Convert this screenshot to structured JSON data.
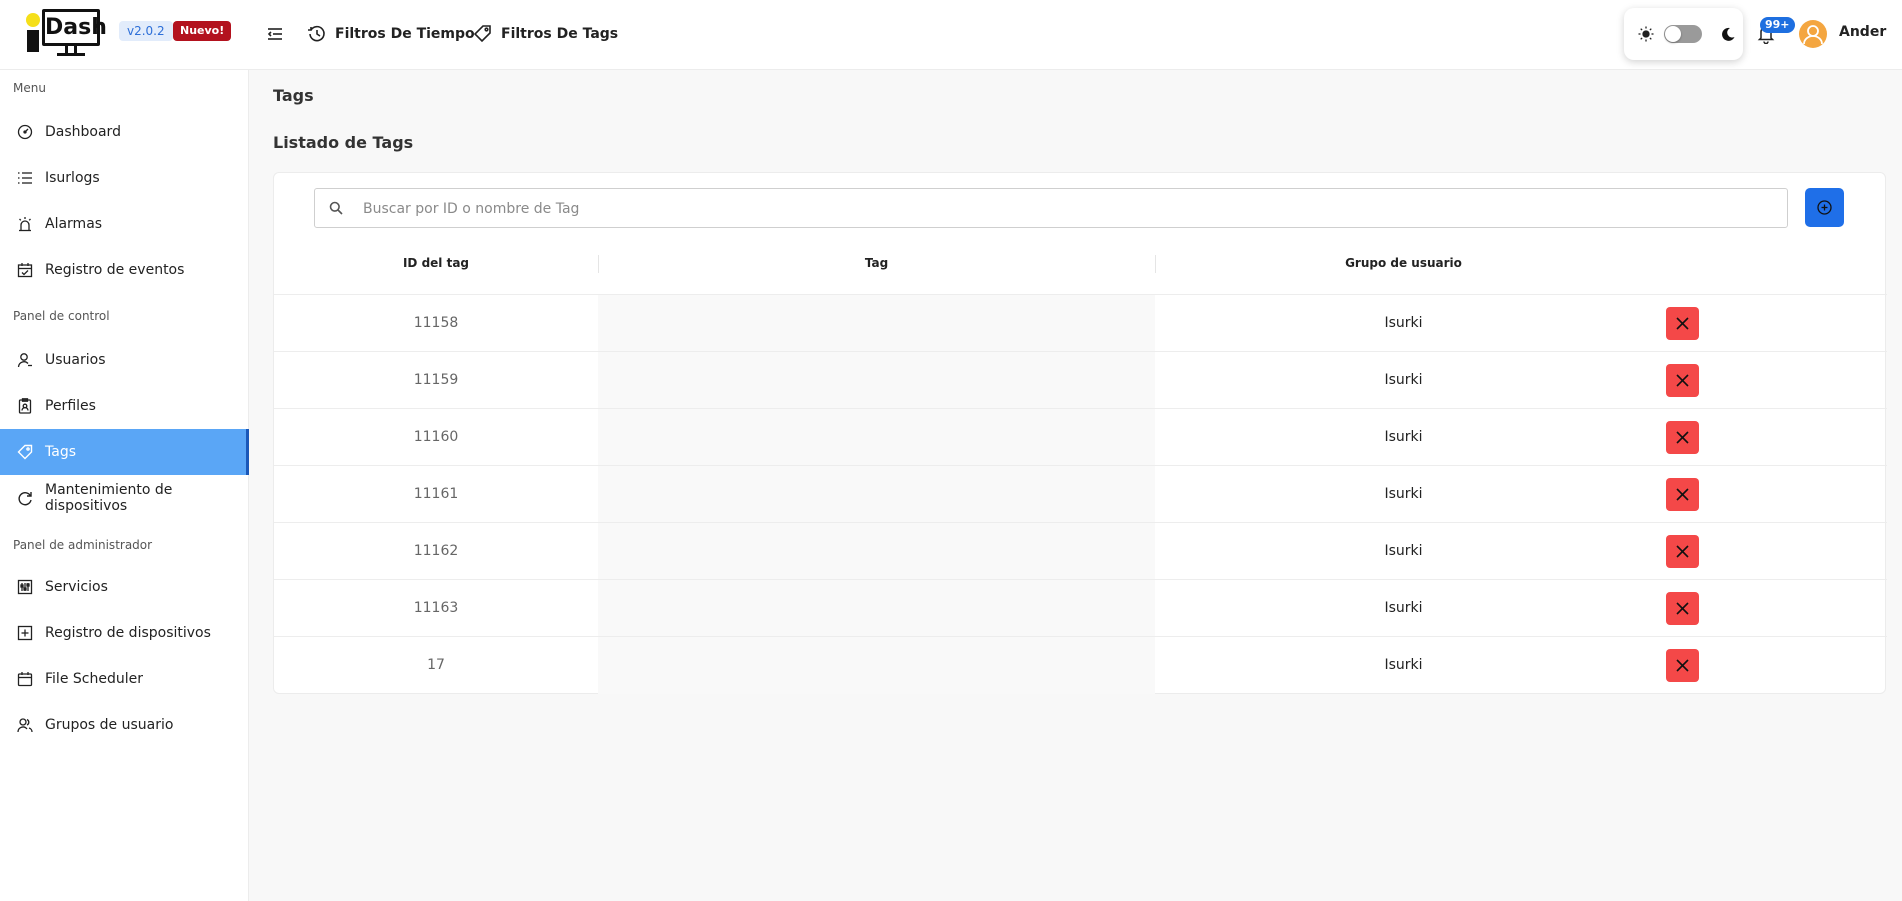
{
  "header": {
    "logo_text": "Dash",
    "version": "v2.0.2",
    "new_badge": "Nuevo!",
    "nav": [
      {
        "label": "Filtros De Tiempo",
        "icon": "time-filter-icon"
      },
      {
        "label": "Filtros De Tags",
        "icon": "tag-icon"
      }
    ],
    "notification_count": "99+",
    "user_name": "Ander"
  },
  "sidebar": {
    "sections": [
      "Menu",
      "Panel de control",
      "Panel de administrador"
    ],
    "items": [
      {
        "label": "Dashboard",
        "icon": "dashboard-icon"
      },
      {
        "label": "Isurlogs",
        "icon": "list-icon"
      },
      {
        "label": "Alarmas",
        "icon": "alarm-icon"
      },
      {
        "label": "Registro de eventos",
        "icon": "calendar-check-icon"
      },
      {
        "label": "Usuarios",
        "icon": "user-icon"
      },
      {
        "label": "Perfiles",
        "icon": "profile-icon"
      },
      {
        "label": "Tags",
        "icon": "tag-icon",
        "active": true
      },
      {
        "label": "Mantenimiento de dispositivos",
        "icon": "refresh-icon"
      },
      {
        "label": "Servicios",
        "icon": "services-icon"
      },
      {
        "label": "Registro de dispositivos",
        "icon": "add-box-icon"
      },
      {
        "label": "File Scheduler",
        "icon": "calendar-icon"
      },
      {
        "label": "Grupos de usuario",
        "icon": "user-group-icon"
      }
    ]
  },
  "main": {
    "page_title": "Tags",
    "list_title": "Listado de Tags",
    "search_placeholder": "Buscar por ID o nombre de Tag",
    "search_value": "",
    "table": {
      "headers": [
        "ID del tag",
        "Tag",
        "Grupo de usuario"
      ],
      "rows": [
        {
          "id": "11158",
          "tag": "",
          "group": "Isurki"
        },
        {
          "id": "11159",
          "tag": "",
          "group": "Isurki"
        },
        {
          "id": "11160",
          "tag": "",
          "group": "Isurki"
        },
        {
          "id": "11161",
          "tag": "",
          "group": "Isurki"
        },
        {
          "id": "11162",
          "tag": "",
          "group": "Isurki"
        },
        {
          "id": "11163",
          "tag": "",
          "group": "Isurki"
        },
        {
          "id": "17",
          "tag": "",
          "group": "Isurki"
        }
      ]
    }
  },
  "colors": {
    "accent": "#1f6fe8",
    "sidebar_active": "#5aa6f6",
    "delete": "#f44848",
    "new_badge": "#b3121e"
  }
}
